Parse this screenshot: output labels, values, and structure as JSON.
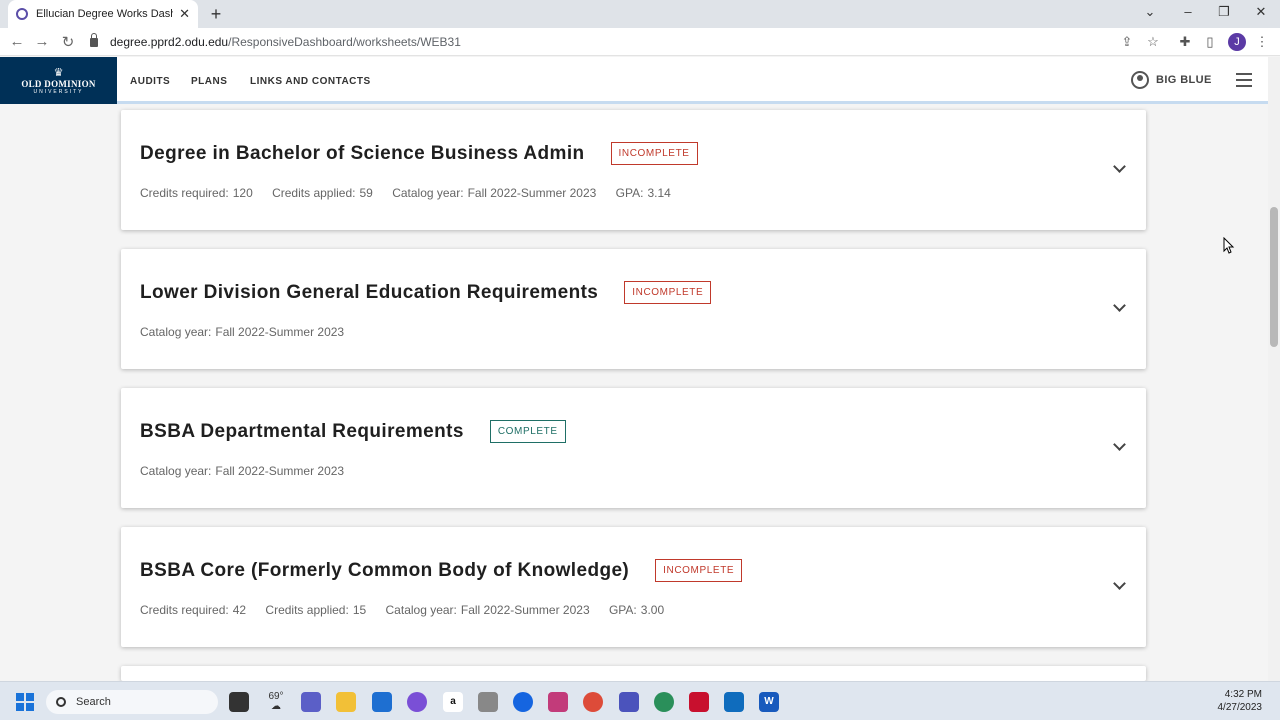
{
  "browser": {
    "tab_title": "Ellucian Degree Works Dashboard",
    "tab_close": "✕",
    "new_tab": "+",
    "url_host": "degree.pprd2.odu.edu",
    "url_path": "/ResponsiveDashboard/worksheets/WEB31",
    "profile_initial": "J"
  },
  "header": {
    "logo_line1": "OLD DOMINION",
    "logo_line2": "UNIVERSITY",
    "nav": [
      "AUDITS",
      "PLANS",
      "LINKS AND CONTACTS"
    ],
    "user_name": "BIG BLUE"
  },
  "cards": [
    {
      "title": "Degree in Bachelor of Science Business Admin",
      "status": "INCOMPLETE",
      "meta": [
        {
          "label": "Credits required:",
          "value": "120"
        },
        {
          "label": "Credits applied:",
          "value": "59"
        },
        {
          "label": "Catalog year:",
          "value": "Fall 2022-Summer 2023"
        },
        {
          "label": "GPA:",
          "value": "3.14"
        }
      ]
    },
    {
      "title": "Lower Division General Education Requirements",
      "status": "INCOMPLETE",
      "meta": [
        {
          "label": "Catalog year:",
          "value": "Fall 2022-Summer 2023"
        }
      ]
    },
    {
      "title": "BSBA Departmental Requirements",
      "status": "COMPLETE",
      "meta": [
        {
          "label": "Catalog year:",
          "value": "Fall 2022-Summer 2023"
        }
      ]
    },
    {
      "title": "BSBA Core (Formerly Common Body of Knowledge)",
      "status": "INCOMPLETE",
      "meta": [
        {
          "label": "Credits required:",
          "value": "42"
        },
        {
          "label": "Credits applied:",
          "value": "15"
        },
        {
          "label": "Catalog year:",
          "value": "Fall 2022-Summer 2023"
        },
        {
          "label": "GPA:",
          "value": "3.00"
        }
      ]
    }
  ],
  "taskbar": {
    "search_label": "Search",
    "weather": "69°",
    "time": "4:32 PM",
    "date": "4/27/2023"
  },
  "colors": {
    "brand_navy": "#003057",
    "incomplete": "#c0392b",
    "complete": "#1f6f66"
  }
}
